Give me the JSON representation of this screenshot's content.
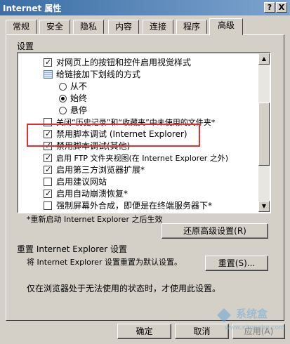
{
  "window": {
    "title": "Internet 属性",
    "help_label": "?",
    "close_label": "X"
  },
  "tabs": [
    {
      "label": "常规"
    },
    {
      "label": "安全"
    },
    {
      "label": "隐私"
    },
    {
      "label": "内容"
    },
    {
      "label": "连接"
    },
    {
      "label": "程序"
    },
    {
      "label": "高级",
      "active": true
    }
  ],
  "settings": {
    "label": "设置",
    "items": [
      {
        "text": "对网页上的按钮和控件启用视觉样式",
        "kind": "checkbox",
        "checked": true
      },
      {
        "text": "给链接加下划线的方式",
        "kind": "group",
        "icon": "underline-group-icon"
      },
      {
        "text": "从不",
        "kind": "radio",
        "selected": false
      },
      {
        "text": "始终",
        "kind": "radio",
        "selected": true
      },
      {
        "text": "悬停",
        "kind": "radio",
        "selected": false
      },
      {
        "text": "关闭“历史记录”和“收藏夹”中未使用的文件夹*",
        "kind": "checkbox",
        "checked": false
      },
      {
        "text": "禁用脚本调试 (Internet Explorer)",
        "kind": "checkbox",
        "checked": true
      },
      {
        "text": "禁用脚本调试(其他)",
        "kind": "checkbox",
        "checked": true
      },
      {
        "text": "启用 FTP 文件夹视图(在 Internet Explorer 之外)",
        "kind": "checkbox",
        "checked": true
      },
      {
        "text": "启用第三方浏览器扩展*",
        "kind": "checkbox",
        "checked": true
      },
      {
        "text": "启用建议网站",
        "kind": "checkbox",
        "checked": false
      },
      {
        "text": "启用自动崩溃恢复*",
        "kind": "checkbox",
        "checked": true
      },
      {
        "text": "强制屏幕外合成，即便是在终端服务器下*",
        "kind": "checkbox",
        "checked": false
      }
    ]
  },
  "restart_note": "*重新启动 Internet Explorer 之后生效",
  "restore_button": "还原高级设置(R)",
  "reset_section": {
    "title": "重置 Internet Explorer 设置",
    "description": "将 Internet Explorer 设置重置为默认设置。",
    "reset_button": "重置(S)...",
    "note": "仅在浏览器处于无法使用的状态时，才使用此设置。"
  },
  "footer": {
    "ok": "确定",
    "cancel": "取消",
    "apply": "应用(A)"
  },
  "colors": {
    "titlebar": "#3a6ea5",
    "highlight": "#e03030",
    "face": "#d4d0c8"
  },
  "watermark": {
    "text": "系统盒",
    "url": "www.xitonghe.com"
  }
}
